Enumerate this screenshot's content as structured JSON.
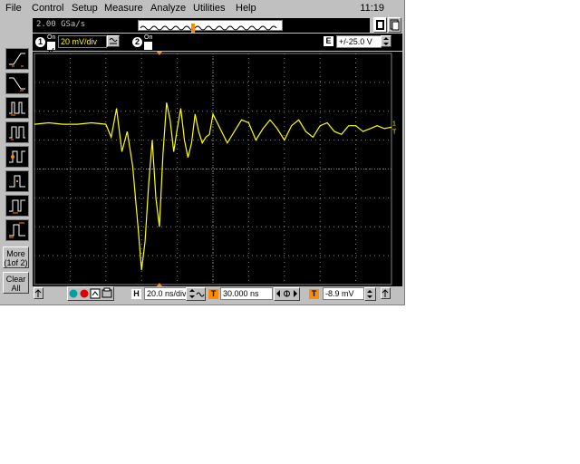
{
  "menu": {
    "items": [
      "File",
      "Control",
      "Setup",
      "Measure",
      "Analyze",
      "Utilities",
      "Help"
    ],
    "clock": "11:19"
  },
  "acquisition": {
    "sample_rate": "2.00 GSa/s"
  },
  "channel1": {
    "number": "1",
    "on_label": "On",
    "scale": "20 mV/div"
  },
  "channel2": {
    "number": "2",
    "on_label": "On"
  },
  "trigger_level_marker": {
    "letter": "E",
    "value": "+/-25.0 V"
  },
  "left_tools": [
    {
      "name": "rising-edge-trigger-icon"
    },
    {
      "name": "falling-edge-trigger-icon"
    },
    {
      "name": "glitch-trigger-icon"
    },
    {
      "name": "pulse-width-trigger-icon"
    },
    {
      "name": "pattern-trigger-icon"
    },
    {
      "name": "state-trigger-icon"
    },
    {
      "name": "timeout-trigger-icon"
    },
    {
      "name": "setup-hold-trigger-icon"
    }
  ],
  "more_button": {
    "line1": "More",
    "line2": "(1of 2)"
  },
  "clear_button": {
    "line1": "Clear",
    "line2": "All"
  },
  "timebase": {
    "letter": "H",
    "scale": "20.0 ns/div",
    "delay_letter": "T",
    "delay": "30.000 ns"
  },
  "trigger": {
    "letter": "T",
    "level": "-8.9 mV"
  },
  "colors": {
    "trace": "#ffff00",
    "grid": "#808080",
    "screen": "#000000",
    "chrome": "#c0c0c0"
  },
  "chart_data": {
    "type": "line",
    "x_divisions": 10,
    "y_divisions": 8,
    "x_unit_per_div": "20.0 ns/div",
    "y_unit_per_div": "20 mV/div",
    "xlim": [
      0,
      10
    ],
    "ylim": [
      -4,
      4
    ],
    "series": [
      {
        "x": [
          0.0,
          0.4,
          0.8,
          1.2,
          1.6,
          2.0,
          2.15,
          2.3,
          2.45,
          2.6,
          2.75,
          2.9,
          3.0,
          3.1,
          3.2,
          3.3,
          3.4,
          3.5,
          3.6,
          3.7,
          3.8,
          3.9,
          4.0,
          4.1,
          4.2,
          4.3,
          4.4,
          4.5,
          4.6,
          4.7,
          4.8,
          4.9,
          5.0,
          5.2,
          5.4,
          5.6,
          5.8,
          6.0,
          6.2,
          6.4,
          6.6,
          6.8,
          7.0,
          7.2,
          7.4,
          7.6,
          7.8,
          8.0,
          8.2,
          8.4,
          8.6,
          8.8,
          9.0,
          9.2,
          9.4,
          9.6,
          9.8,
          10.0
        ],
        "values": [
          1.55,
          1.6,
          1.55,
          1.55,
          1.6,
          1.55,
          1.1,
          2.1,
          0.6,
          1.3,
          0.1,
          -2.0,
          -3.5,
          -2.5,
          -0.5,
          1.0,
          -1.0,
          -2.0,
          0.5,
          2.3,
          1.7,
          0.6,
          1.4,
          2.1,
          1.0,
          0.4,
          0.9,
          1.9,
          1.3,
          0.9,
          1.1,
          1.2,
          1.9,
          1.4,
          0.9,
          1.3,
          1.7,
          1.6,
          1.0,
          1.4,
          1.7,
          1.4,
          1.0,
          1.5,
          1.7,
          1.3,
          1.1,
          1.5,
          1.6,
          1.3,
          1.2,
          1.5,
          1.5,
          1.3,
          1.4,
          1.5,
          1.4,
          1.45
        ]
      }
    ]
  }
}
